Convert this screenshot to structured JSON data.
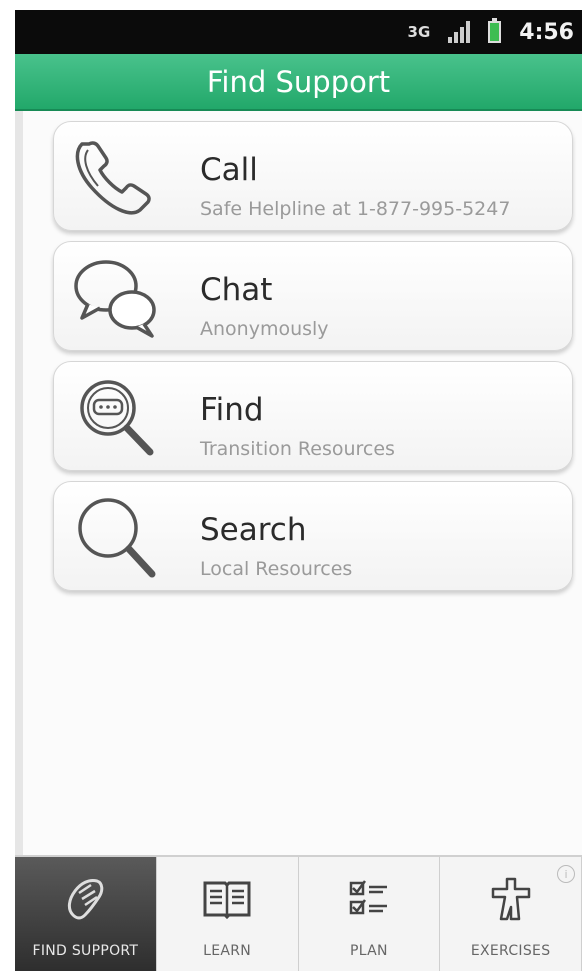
{
  "status_bar": {
    "network": "3G",
    "time": "4:56"
  },
  "header": {
    "title": "Find Support"
  },
  "options": [
    {
      "label": "Call",
      "subtitle": "Safe Helpline at 1-877-995-5247",
      "icon": "phone-icon"
    },
    {
      "label": "Chat",
      "subtitle": "Anonymously",
      "icon": "chat-bubbles-icon"
    },
    {
      "label": "Find",
      "subtitle": "Transition Resources",
      "icon": "magnifier-chat-icon"
    },
    {
      "label": "Search",
      "subtitle": "Local Resources",
      "icon": "magnifier-icon"
    }
  ],
  "bottom_nav": {
    "active": "FIND SUPPORT",
    "tabs": [
      {
        "label": "FIND SUPPORT",
        "icon": "hand-icon"
      },
      {
        "label": "LEARN",
        "icon": "book-icon"
      },
      {
        "label": "PLAN",
        "icon": "checklist-icon"
      },
      {
        "label": "EXERCISES",
        "icon": "figure-icon"
      }
    ],
    "info_glyph": "i"
  },
  "colors": {
    "header_green": "#2fb377",
    "active_tab": "#3a3a3a"
  }
}
